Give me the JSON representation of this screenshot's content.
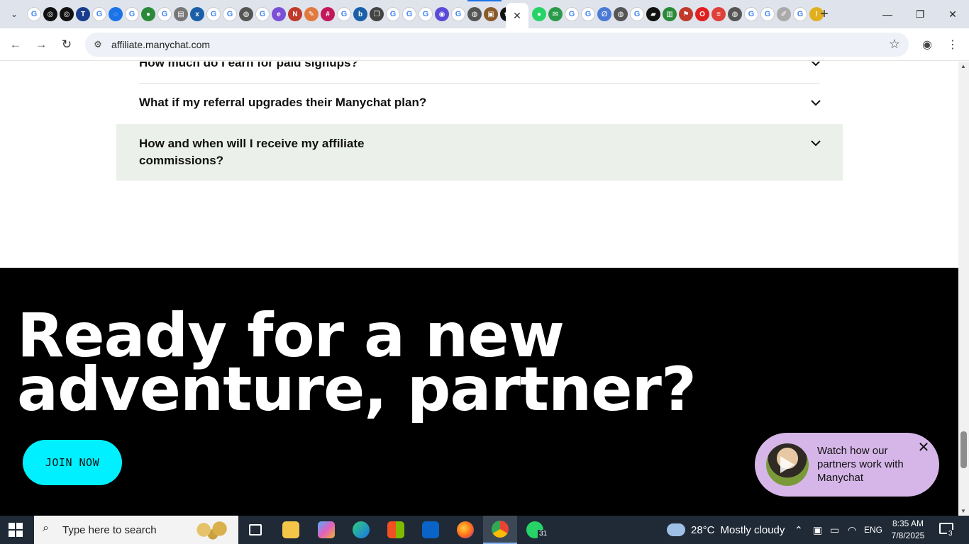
{
  "browser": {
    "url": "affiliate.manychat.com",
    "favicons": [
      {
        "icon": "google-icon",
        "color": "#4285f4",
        "glyph": "G"
      },
      {
        "icon": "chatgpt-icon",
        "color": "#111111",
        "glyph": "◎"
      },
      {
        "icon": "chatgpt-icon",
        "color": "#111111",
        "glyph": "◎"
      },
      {
        "icon": "ttp-icon",
        "color": "#1a3c8c",
        "glyph": "T"
      },
      {
        "icon": "google-icon",
        "color": "#4285f4",
        "glyph": "G"
      },
      {
        "icon": "loading-icon",
        "color": "#1a73e8",
        "glyph": "◌"
      },
      {
        "icon": "google-icon",
        "color": "#4285f4",
        "glyph": "G"
      },
      {
        "icon": "globe-green-icon",
        "color": "#2a8a3a",
        "glyph": "●"
      },
      {
        "icon": "google-icon",
        "color": "#4285f4",
        "glyph": "G"
      },
      {
        "icon": "printer-icon",
        "color": "#777777",
        "glyph": "▤"
      },
      {
        "icon": "xf-icon",
        "color": "#1a5fa8",
        "glyph": "x"
      },
      {
        "icon": "google-icon",
        "color": "#4285f4",
        "glyph": "G"
      },
      {
        "icon": "google-icon",
        "color": "#4285f4",
        "glyph": "G"
      },
      {
        "icon": "globe-icon",
        "color": "#555555",
        "glyph": "◍"
      },
      {
        "icon": "google-icon",
        "color": "#4285f4",
        "glyph": "G"
      },
      {
        "icon": "edge-icon",
        "color": "#7b4fd6",
        "glyph": "e"
      },
      {
        "icon": "news-icon",
        "color": "#c0392b",
        "glyph": "N"
      },
      {
        "icon": "brush-icon",
        "color": "#e07a3f",
        "glyph": "✎"
      },
      {
        "icon": "slack-icon",
        "color": "#c2185b",
        "glyph": "#"
      },
      {
        "icon": "google-icon",
        "color": "#4285f4",
        "glyph": "G"
      },
      {
        "icon": "bing-icon",
        "color": "#1a5fa8",
        "glyph": "b"
      },
      {
        "icon": "copy-icon",
        "color": "#444444",
        "glyph": "❐"
      },
      {
        "icon": "google-icon",
        "color": "#4285f4",
        "glyph": "G"
      },
      {
        "icon": "google-icon",
        "color": "#4285f4",
        "glyph": "G"
      },
      {
        "icon": "google-icon",
        "color": "#4285f4",
        "glyph": "G"
      },
      {
        "icon": "circle-icon",
        "color": "#5b4bd6",
        "glyph": "◉"
      },
      {
        "icon": "google-icon",
        "color": "#4285f4",
        "glyph": "G"
      },
      {
        "icon": "globe-icon",
        "color": "#555555",
        "glyph": "◍"
      },
      {
        "icon": "photo-icon",
        "color": "#8a5a2a",
        "glyph": "▣"
      },
      {
        "icon": "openai-icon",
        "color": "#111111",
        "glyph": "✿"
      }
    ],
    "favicons_right": [
      {
        "icon": "whatsapp-icon",
        "color": "#25d366",
        "glyph": "●"
      },
      {
        "icon": "message-icon",
        "color": "#2a9a4a",
        "glyph": "✉"
      },
      {
        "icon": "google-icon",
        "color": "#4285f4",
        "glyph": "G"
      },
      {
        "icon": "google-icon",
        "color": "#4285f4",
        "glyph": "G"
      },
      {
        "icon": "link-icon",
        "color": "#4a7ad6",
        "glyph": "∅"
      },
      {
        "icon": "globe-icon",
        "color": "#555555",
        "glyph": "◍"
      },
      {
        "icon": "google-icon",
        "color": "#4285f4",
        "glyph": "G"
      },
      {
        "icon": "notes-icon",
        "color": "#111111",
        "glyph": "▰"
      },
      {
        "icon": "chart-icon",
        "color": "#2a8a3a",
        "glyph": "▥"
      },
      {
        "icon": "flag-icon",
        "color": "#c0392b",
        "glyph": "⚑"
      },
      {
        "icon": "opera-icon",
        "color": "#e02020",
        "glyph": "O"
      },
      {
        "icon": "stripes-icon",
        "color": "#e0403a",
        "glyph": "≡"
      },
      {
        "icon": "globe-icon",
        "color": "#555555",
        "glyph": "◍"
      },
      {
        "icon": "google-icon",
        "color": "#4285f4",
        "glyph": "G"
      },
      {
        "icon": "google-icon",
        "color": "#4285f4",
        "glyph": "G"
      },
      {
        "icon": "pen-icon",
        "color": "#aaaaaa",
        "glyph": "✐"
      },
      {
        "icon": "google-icon",
        "color": "#4285f4",
        "glyph": "G"
      },
      {
        "icon": "info-icon",
        "color": "#e0b020",
        "glyph": "!"
      }
    ]
  },
  "faq": {
    "items": [
      {
        "question": "How much do I earn for paid signups?"
      },
      {
        "question": "What if my referral upgrades their Manychat plan?"
      },
      {
        "question_line1": "How and when will I receive my affiliate",
        "question_line2": "commissions?"
      }
    ]
  },
  "cta": {
    "headline_line1": "Ready for a new",
    "headline_line2": "adventure, partner?",
    "join_label": "JOIN NOW",
    "accent_color": "#00f0ff"
  },
  "video_popup": {
    "text": "Watch how our partners work with Manychat",
    "background": "#d6b6e8"
  },
  "taskbar": {
    "search_placeholder": "Type here to search",
    "whatsapp_badge": "31",
    "temperature": "28°C",
    "weather": "Mostly cloudy",
    "language": "ENG",
    "time": "8:35 AM",
    "date": "7/8/2025",
    "notification_count": "3"
  }
}
